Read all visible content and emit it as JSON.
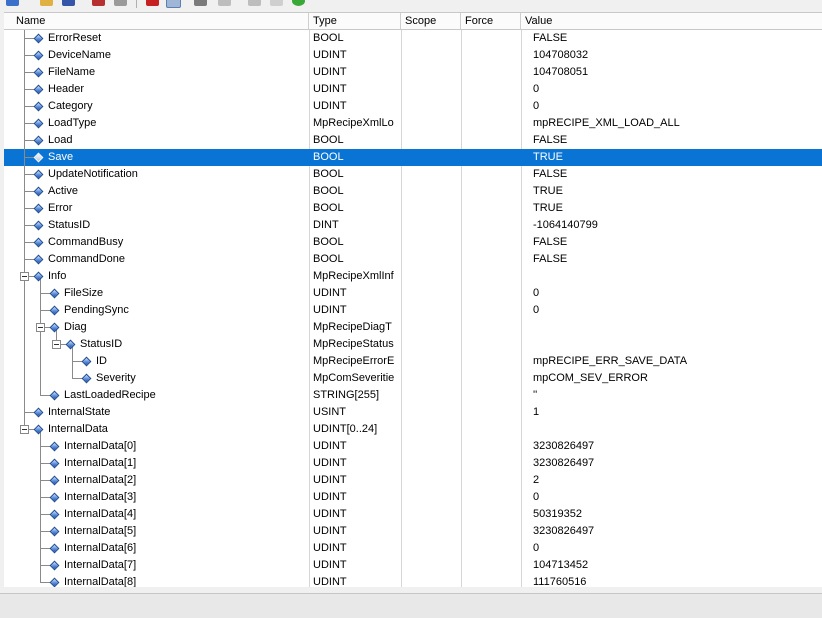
{
  "columns": [
    "Name",
    "Type",
    "Scope",
    "Force",
    "Value"
  ],
  "rows": [
    {
      "name": "ErrorReset",
      "type": "BOOL",
      "value": "FALSE"
    },
    {
      "name": "DeviceName",
      "type": "UDINT",
      "value": "104708032"
    },
    {
      "name": "FileName",
      "type": "UDINT",
      "value": "104708051"
    },
    {
      "name": "Header",
      "type": "UDINT",
      "value": "0"
    },
    {
      "name": "Category",
      "type": "UDINT",
      "value": "0"
    },
    {
      "name": "LoadType",
      "type": "MpRecipeXmlLo",
      "value": "mpRECIPE_XML_LOAD_ALL"
    },
    {
      "name": "Load",
      "type": "BOOL",
      "value": "FALSE"
    },
    {
      "name": "Save",
      "type": "BOOL",
      "value": "TRUE",
      "selected": true
    },
    {
      "name": "UpdateNotification",
      "type": "BOOL",
      "value": "FALSE"
    },
    {
      "name": "Active",
      "type": "BOOL",
      "value": "TRUE"
    },
    {
      "name": "Error",
      "type": "BOOL",
      "value": "TRUE"
    },
    {
      "name": "StatusID",
      "type": "DINT",
      "value": "-1064140799"
    },
    {
      "name": "CommandBusy",
      "type": "BOOL",
      "value": "FALSE"
    },
    {
      "name": "CommandDone",
      "type": "BOOL",
      "value": "FALSE"
    },
    {
      "name": "Info",
      "type": "MpRecipeXmlInf",
      "value": "",
      "expanded": true
    },
    {
      "name": "FileSize",
      "type": "UDINT",
      "value": "0"
    },
    {
      "name": "PendingSync",
      "type": "UDINT",
      "value": "0"
    },
    {
      "name": "Diag",
      "type": "MpRecipeDiagT",
      "value": "",
      "expanded": true
    },
    {
      "name": "StatusID",
      "type": "MpRecipeStatus",
      "value": "",
      "expanded": true
    },
    {
      "name": "ID",
      "type": "MpRecipeErrorE",
      "value": "mpRECIPE_ERR_SAVE_DATA"
    },
    {
      "name": "Severity",
      "type": "MpComSeveritie",
      "value": "mpCOM_SEV_ERROR"
    },
    {
      "name": "LastLoadedRecipe",
      "type": "STRING[255]",
      "value": "''"
    },
    {
      "name": "InternalState",
      "type": "USINT",
      "value": "1"
    },
    {
      "name": "InternalData",
      "type": "UDINT[0..24]",
      "value": "",
      "expanded": true
    },
    {
      "name": "InternalData[0]",
      "type": "UDINT",
      "value": "3230826497"
    },
    {
      "name": "InternalData[1]",
      "type": "UDINT",
      "value": "3230826497"
    },
    {
      "name": "InternalData[2]",
      "type": "UDINT",
      "value": "2"
    },
    {
      "name": "InternalData[3]",
      "type": "UDINT",
      "value": "0"
    },
    {
      "name": "InternalData[4]",
      "type": "UDINT",
      "value": "50319352"
    },
    {
      "name": "InternalData[5]",
      "type": "UDINT",
      "value": "3230826497"
    },
    {
      "name": "InternalData[6]",
      "type": "UDINT",
      "value": "0"
    },
    {
      "name": "InternalData[7]",
      "type": "UDINT",
      "value": "104713452"
    },
    {
      "name": "InternalData[8]",
      "type": "UDINT",
      "value": "111760516"
    }
  ]
}
